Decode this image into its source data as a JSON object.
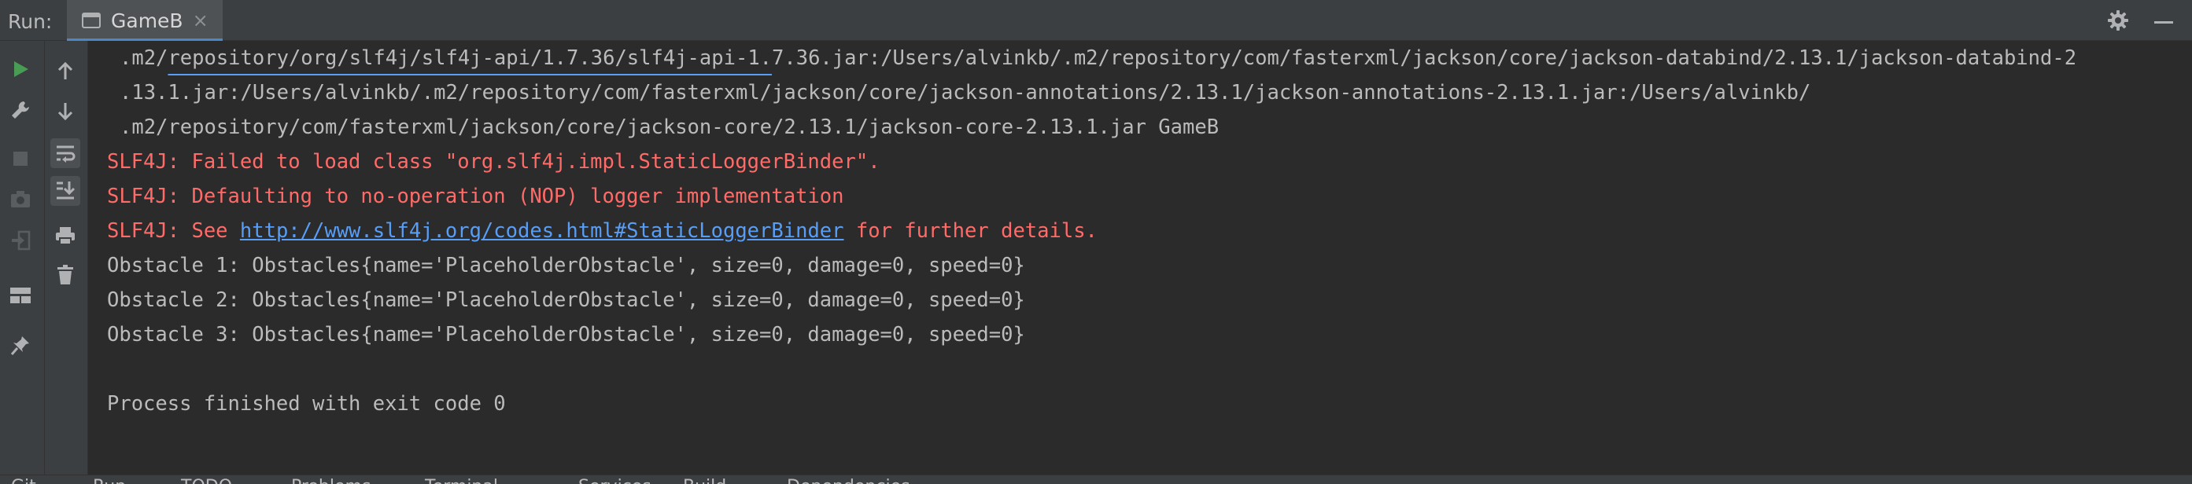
{
  "header": {
    "run_label": "Run:",
    "tab_title": "GameB",
    "tab_close": "×",
    "icons": [
      "console-tab-icon",
      "close-icon",
      "gear-icon",
      "minimize-icon"
    ]
  },
  "toolbar": {
    "buttons": [
      "run-icon",
      "wrench-icon",
      "stop-icon",
      "camera-icon",
      "login-icon",
      "layout-icon",
      "pin-icon",
      "up-arrow-icon",
      "down-arrow-icon",
      "soft-wrap-icon",
      "scroll-to-end-icon",
      "print-icon",
      "trash-icon"
    ]
  },
  "console": {
    "lines": [
      ".m2/repository/org/slf4j/slf4j-api/1.7.36/slf4j-api-1.7.36.jar:/Users/alvinkb/.m2/repository/com/fasterxml/jackson/core/jackson-databind/2.13.1/jackson-databind-2",
      ".13.1.jar:/Users/alvinkb/.m2/repository/com/fasterxml/jackson/core/jackson-annotations/2.13.1/jackson-annotations-2.13.1.jar:/Users/alvinkb/",
      ".m2/repository/com/fasterxml/jackson/core/jackson-core/2.13.1/jackson-core-2.13.1.jar GameB",
      "SLF4J: Failed to load class \"org.slf4j.impl.StaticLoggerBinder\".",
      "SLF4J: Defaulting to no-operation (NOP) logger implementation",
      "Obstacle 1: Obstacles{name='PlaceholderObstacle', size=0, damage=0, speed=0}",
      "Obstacle 2: Obstacles{name='PlaceholderObstacle', size=0, damage=0, speed=0}",
      "Obstacle 3: Obstacles{name='PlaceholderObstacle', size=0, damage=0, speed=0}",
      "Process finished with exit code 0"
    ],
    "see_line": {
      "prefix": "SLF4J: See ",
      "link": "http://www.slf4j.org/codes.html#StaticLoggerBinder",
      "suffix": " for further details."
    }
  },
  "bottom_tabs": [
    "Git",
    "Run",
    "TODO",
    "Problems",
    "Terminal",
    "Services",
    "Build",
    "Dependencies"
  ],
  "colors": {
    "background": "#2b2b2b",
    "panel": "#3c3f41",
    "error_text": "#ff6b68",
    "link": "#589df6",
    "run_green": "#499c54",
    "accent": "#4a88c7"
  }
}
